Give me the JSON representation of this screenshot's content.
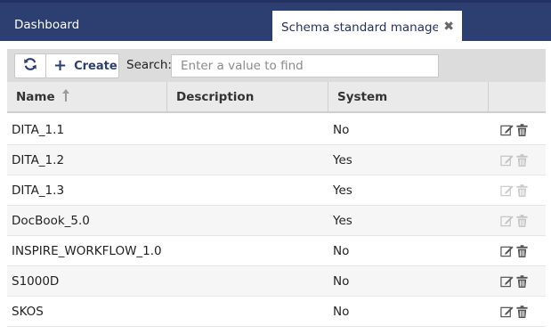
{
  "tabs": {
    "dashboard_label": "Dashboard",
    "active_label": "Schema standard manage...",
    "close_symbol": "✖"
  },
  "toolbar": {
    "create_label": "Create",
    "search_label": "Search:",
    "search_placeholder": "Enter a value to find",
    "search_value": ""
  },
  "table": {
    "columns": {
      "name": "Name",
      "description": "Description",
      "system": "System",
      "actions": ""
    },
    "sort": {
      "column": "name",
      "direction": "ascending",
      "icon": "sort-up-arrow-icon"
    },
    "rows": [
      {
        "name": "DITA_1.1",
        "description": "",
        "system": "No",
        "actions_enabled": true
      },
      {
        "name": "DITA_1.2",
        "description": "",
        "system": "Yes",
        "actions_enabled": false
      },
      {
        "name": "DITA_1.3",
        "description": "",
        "system": "Yes",
        "actions_enabled": false
      },
      {
        "name": "DocBook_5.0",
        "description": "",
        "system": "Yes",
        "actions_enabled": false
      },
      {
        "name": "INSPIRE_WORKFLOW_1.0",
        "description": "",
        "system": "No",
        "actions_enabled": true
      },
      {
        "name": "S1000D",
        "description": "",
        "system": "No",
        "actions_enabled": true
      },
      {
        "name": "SKOS",
        "description": "",
        "system": "No",
        "actions_enabled": true
      }
    ]
  },
  "colors": {
    "tabbar": "#2d3f71",
    "accent": "#2d3f71",
    "toolbar": "#dcdcdc",
    "header": "#eaeaea"
  }
}
